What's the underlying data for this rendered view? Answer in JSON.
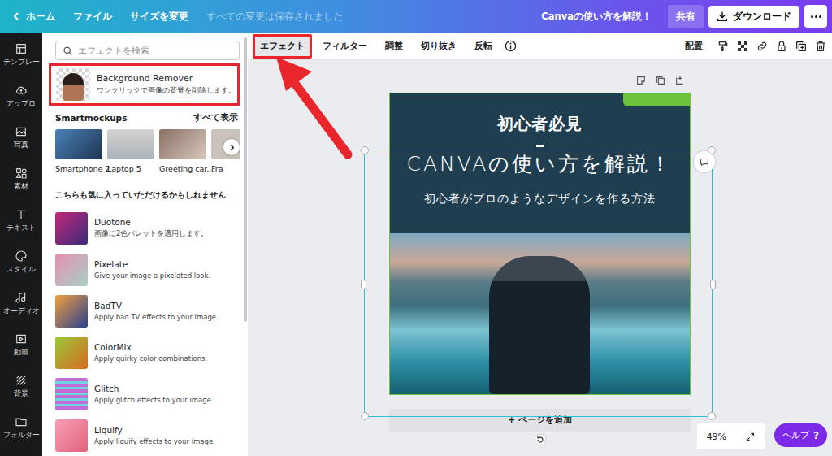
{
  "topbar": {
    "back": "ホーム",
    "menu": [
      "ファイル",
      "サイズを変更"
    ],
    "save_status": "すべての変更は保存されました",
    "title": "Canvaの使い方を解説！",
    "share": "共有",
    "download": "ダウンロード"
  },
  "rail": [
    {
      "label": "テンプレー"
    },
    {
      "label": "アップロ"
    },
    {
      "label": "写真"
    },
    {
      "label": "素材"
    },
    {
      "label": "テキスト"
    },
    {
      "label": "スタイル"
    },
    {
      "label": "オーディオ"
    },
    {
      "label": "動画"
    },
    {
      "label": "背景"
    },
    {
      "label": "フォルダー"
    }
  ],
  "panel": {
    "search": {
      "placeholder": "エフェクトを検索"
    },
    "featured": {
      "title": "Background Remover",
      "desc": "ワンクリックで画像の背景を削除します。",
      "annotated": true
    },
    "mockups": {
      "title": "Smartmockups",
      "see_all": "すべて表示",
      "items": [
        "Smartphone 2",
        "Laptop 5",
        "Greeting car...",
        "Fra"
      ]
    },
    "suggest_title": "こちらも気に入っていただけるかもしれません",
    "effects": [
      {
        "name": "Duotone",
        "desc": "画像に2色パレットを適用します。"
      },
      {
        "name": "Pixelate",
        "desc": "Give your image a pixelated look."
      },
      {
        "name": "BadTV",
        "desc": "Apply bad TV effects to your image."
      },
      {
        "name": "ColorMix",
        "desc": "Apply quirky color combinations."
      },
      {
        "name": "Glitch",
        "desc": "Apply glitch effects to your image."
      },
      {
        "name": "Liquify",
        "desc": "Apply liquify effects to your image."
      }
    ]
  },
  "toolbar": {
    "tabs": [
      {
        "label": "エフェクト",
        "selected": true,
        "annotated": true
      },
      {
        "label": "フィルター",
        "selected": false,
        "annotated": false
      },
      {
        "label": "調整",
        "selected": false,
        "annotated": false
      },
      {
        "label": "切り抜き",
        "selected": false,
        "annotated": false
      },
      {
        "label": "反転",
        "selected": false,
        "annotated": false
      }
    ],
    "arrange": "配置"
  },
  "design": {
    "eyebrow": "初心者必見",
    "title": "CANVAの使い方を解説！",
    "subtitle": "初心者がプロのようなデザインを作る方法"
  },
  "add_page": "+ ページを追加",
  "zoom": "49%",
  "help": {
    "label": "ヘルプ",
    "icon": "?"
  }
}
